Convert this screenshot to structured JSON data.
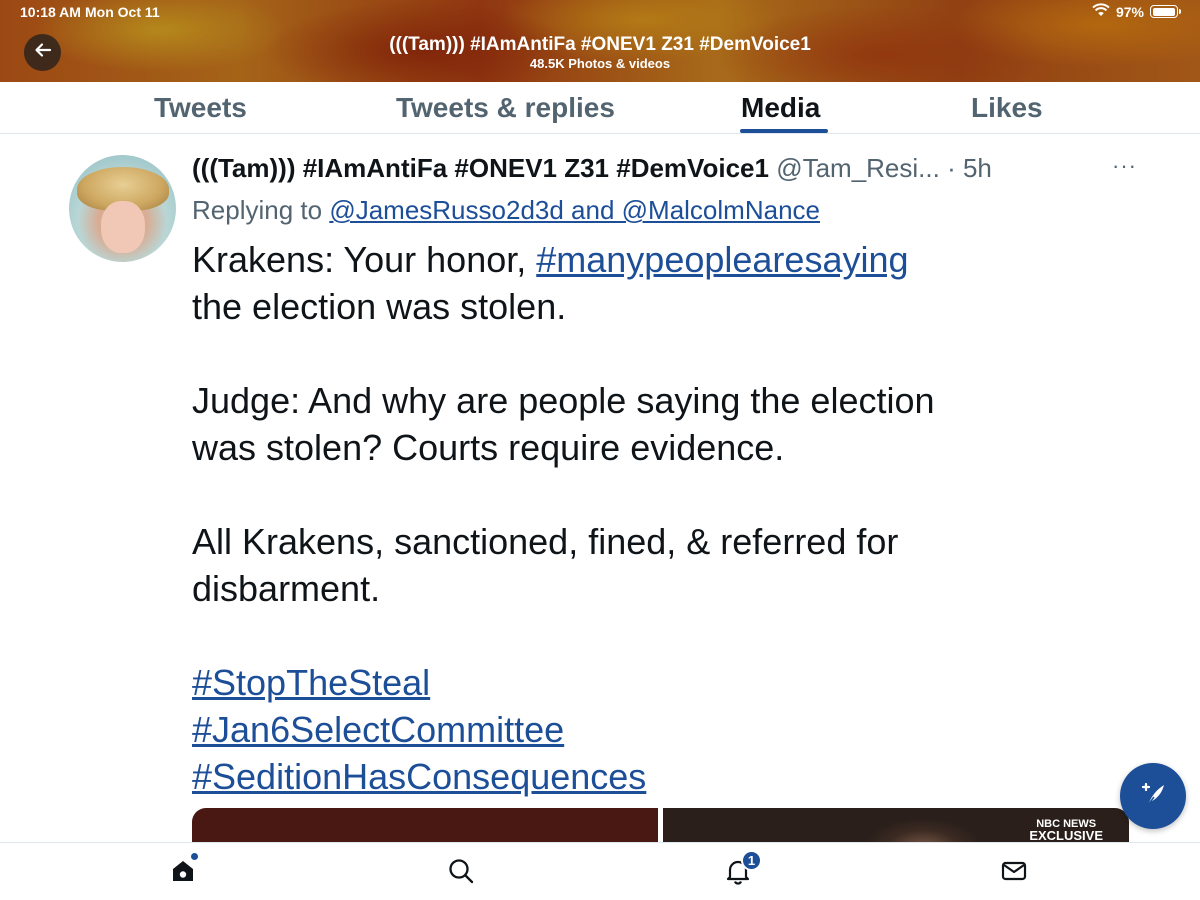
{
  "status_bar": {
    "time": "10:18 AM",
    "date": "Mon Oct 11",
    "battery": "97%",
    "battery_level": 0.97
  },
  "profile": {
    "name": "(((Tam))) #IAmAntiFa #ONEV1 Z31 #DemVoice1",
    "subtitle": "48.5K Photos & videos"
  },
  "tabs": [
    {
      "label": "Tweets",
      "active": false
    },
    {
      "label": "Tweets & replies",
      "active": false
    },
    {
      "label": "Media",
      "active": true
    },
    {
      "label": "Likes",
      "active": false
    }
  ],
  "tweet": {
    "author_name": "(((Tam))) #IAmAntiFa #ONEV1 Z31 #DemVoice1",
    "handle": "@Tam_Resi...",
    "separator": " · ",
    "time": "5h",
    "more": "···",
    "replying_prefix": "Replying to ",
    "replying_to": "@JamesRusso2d3d and @MalcolmNance",
    "body": {
      "line1_prefix": "Krakens: Your honor, ",
      "line1_hashtag": "#manypeoplearesaying",
      "line2": "the election was stolen.",
      "line3": "Judge: And why are people saying the election",
      "line4": "was stolen?  Courts require evidence.",
      "line5": "All Krakens, sanctioned, fined, & referred for",
      "line6": "disbarment."
    },
    "hashtags": [
      "#StopTheSteal",
      "#Jan6SelectCommittee",
      "#SeditionHasConsequences"
    ],
    "media_badge": {
      "line1": "NBC NEWS",
      "line2": "EXCLUSIVE"
    }
  },
  "bottom_nav": {
    "notifications_count": "1"
  },
  "colors": {
    "accent": "#1d4e98",
    "text": "#0f1419",
    "secondary_text": "#536471"
  },
  "icons": [
    "back-arrow-icon",
    "wifi-icon",
    "battery-icon",
    "more-icon",
    "compose-icon",
    "home-icon",
    "search-icon",
    "bell-icon",
    "mail-icon"
  ]
}
